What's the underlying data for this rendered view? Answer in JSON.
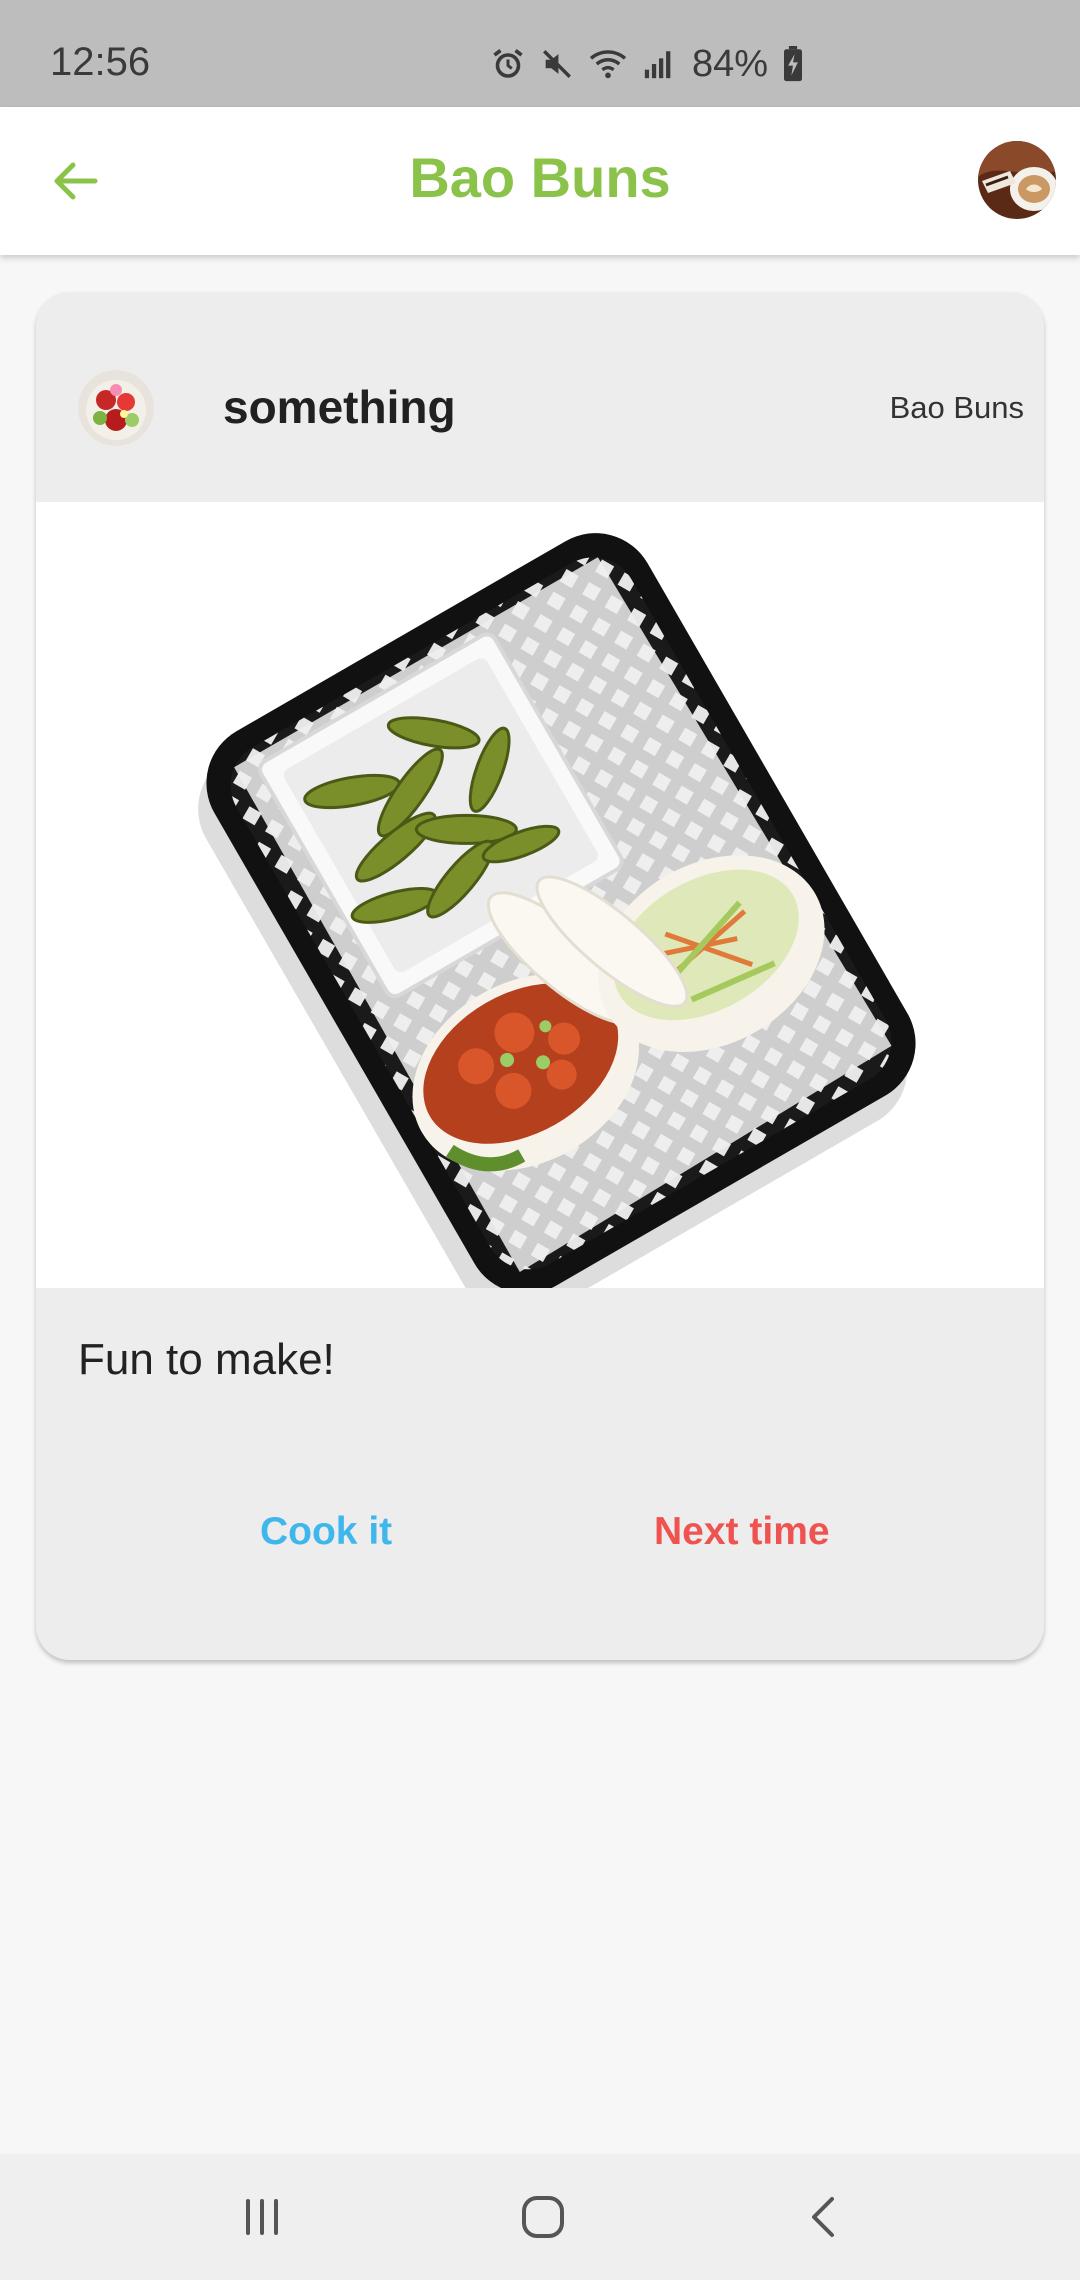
{
  "status_bar": {
    "time": "12:56",
    "battery_percent": "84%",
    "icons": [
      "alarm-icon",
      "mute-icon",
      "wifi-icon",
      "signal-icon",
      "battery-charging-icon"
    ]
  },
  "app_bar": {
    "title": "Bao Buns",
    "back_icon": "arrow-left-icon",
    "accent_color": "#8bc34a"
  },
  "post": {
    "poster_name": "something",
    "recipe_tag": "Bao Buns",
    "comment": "Fun to make!",
    "actions": {
      "cook_label": "Cook it",
      "cook_color": "#3fb6ec",
      "next_label": "Next time",
      "next_color": "#ef5350"
    }
  },
  "nav_bar": {
    "icons": [
      "recent-apps-icon",
      "home-icon",
      "back-nav-icon"
    ]
  }
}
